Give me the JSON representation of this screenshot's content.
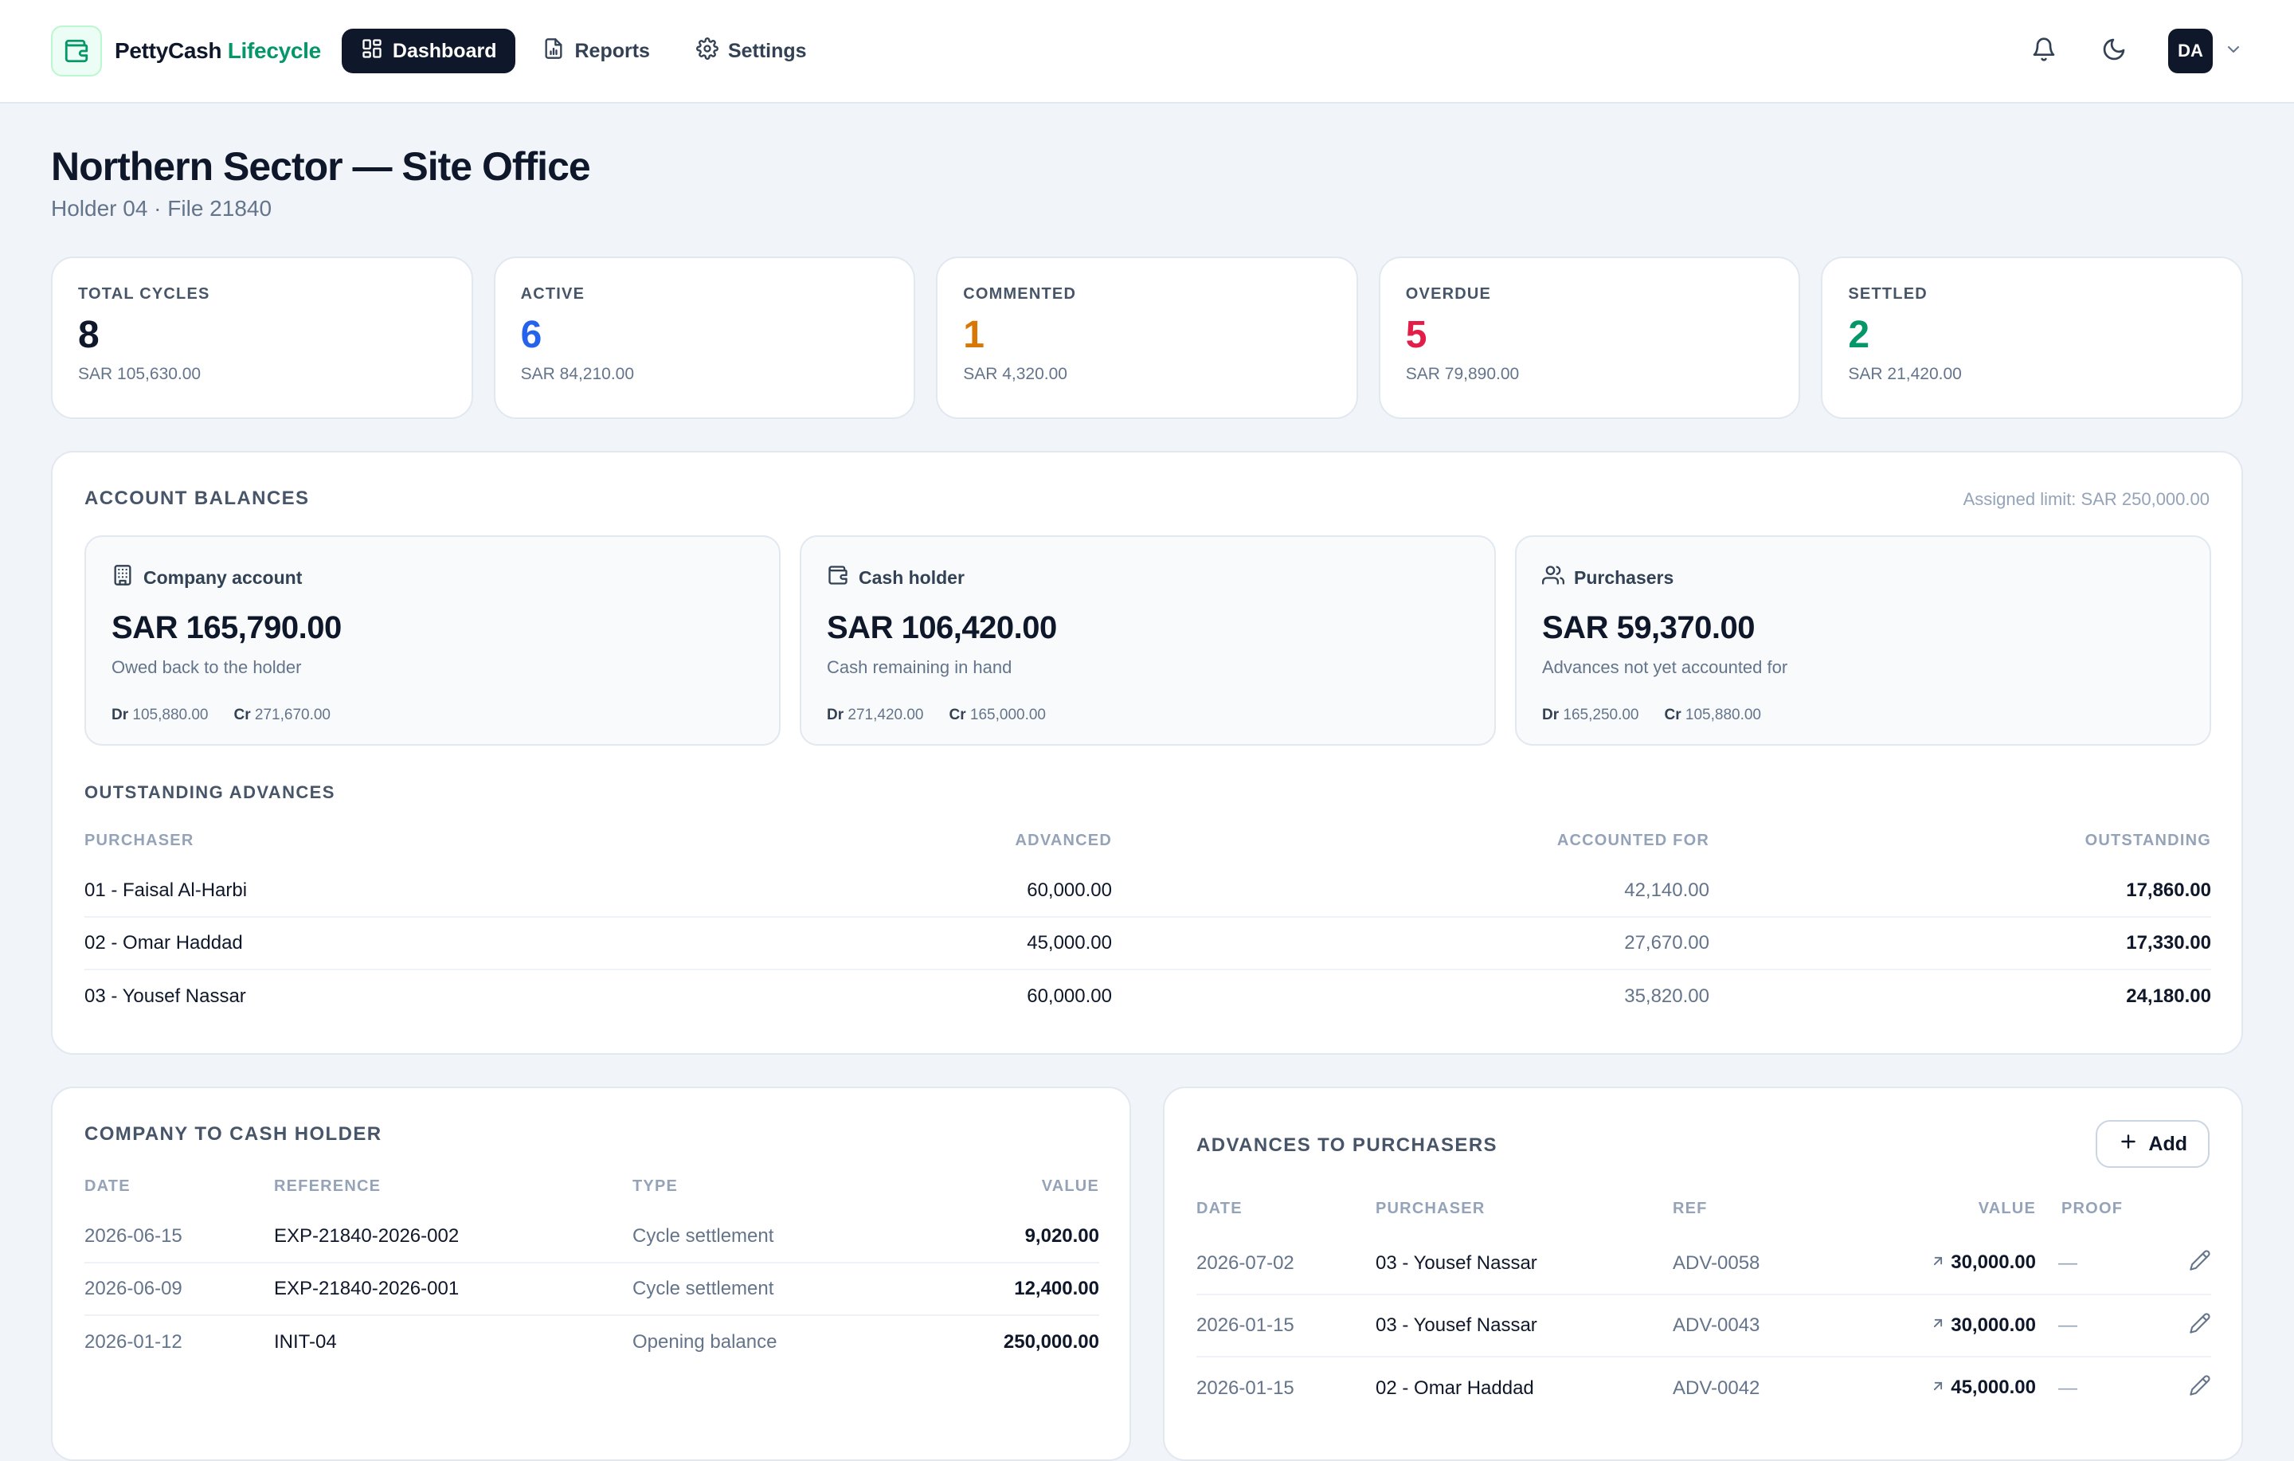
{
  "app": {
    "brand_main": "PettyCash",
    "brand_accent": "Lifecycle"
  },
  "nav": {
    "dashboard": "Dashboard",
    "reports": "Reports",
    "settings": "Settings"
  },
  "user": {
    "initials": "DA"
  },
  "page": {
    "title": "Northern Sector — Site Office",
    "subtitle": "Holder 04 · File 21840"
  },
  "stats": [
    {
      "label": "TOTAL CYCLES",
      "count": "8",
      "amount": "SAR 105,630.00",
      "color": "#0f172a"
    },
    {
      "label": "ACTIVE",
      "count": "6",
      "amount": "SAR 84,210.00",
      "color": "#2563eb"
    },
    {
      "label": "COMMENTED",
      "count": "1",
      "amount": "SAR 4,320.00",
      "color": "#d97706"
    },
    {
      "label": "OVERDUE",
      "count": "5",
      "amount": "SAR 79,890.00",
      "color": "#e11d48"
    },
    {
      "label": "SETTLED",
      "count": "2",
      "amount": "SAR 21,420.00",
      "color": "#059669"
    }
  ],
  "balances": {
    "title": "ACCOUNT BALANCES",
    "limit": "Assigned limit: SAR 250,000.00",
    "accounts": [
      {
        "name": "Company account",
        "icon": "building-icon",
        "amount": "SAR 165,790.00",
        "desc": "Owed back to the holder",
        "dr_label": "Dr",
        "dr": "105,880.00",
        "cr_label": "Cr",
        "cr": "271,670.00"
      },
      {
        "name": "Cash holder",
        "icon": "wallet-icon",
        "amount": "SAR 106,420.00",
        "desc": "Cash remaining in hand",
        "dr_label": "Dr",
        "dr": "271,420.00",
        "cr_label": "Cr",
        "cr": "165,000.00"
      },
      {
        "name": "Purchasers",
        "icon": "users-icon",
        "amount": "SAR 59,370.00",
        "desc": "Advances not yet accounted for",
        "dr_label": "Dr",
        "dr": "165,250.00",
        "cr_label": "Cr",
        "cr": "105,880.00"
      }
    ]
  },
  "outstanding": {
    "title": "OUTSTANDING ADVANCES",
    "columns": [
      "PURCHASER",
      "ADVANCED",
      "ACCOUNTED FOR",
      "OUTSTANDING"
    ],
    "rows": [
      {
        "purchaser": "01 - Faisal Al-Harbi",
        "advanced": "60,000.00",
        "accounted": "42,140.00",
        "outstanding": "17,860.00"
      },
      {
        "purchaser": "02 - Omar Haddad",
        "advanced": "45,000.00",
        "accounted": "27,670.00",
        "outstanding": "17,330.00"
      },
      {
        "purchaser": "03 - Yousef Nassar",
        "advanced": "60,000.00",
        "accounted": "35,820.00",
        "outstanding": "24,180.00"
      }
    ]
  },
  "company_to_holder": {
    "title": "COMPANY TO CASH HOLDER",
    "columns": [
      "DATE",
      "REFERENCE",
      "TYPE",
      "VALUE"
    ],
    "rows": [
      {
        "date": "2026-06-15",
        "reference": "EXP-21840-2026-002",
        "type": "Cycle settlement",
        "value": "9,020.00"
      },
      {
        "date": "2026-06-09",
        "reference": "EXP-21840-2026-001",
        "type": "Cycle settlement",
        "value": "12,400.00"
      },
      {
        "date": "2026-01-12",
        "reference": "INIT-04",
        "type": "Opening balance",
        "value": "250,000.00"
      }
    ]
  },
  "advances": {
    "title": "ADVANCES TO PURCHASERS",
    "add_label": "Add",
    "columns": [
      "DATE",
      "PURCHASER",
      "REF",
      "VALUE",
      "PROOF"
    ],
    "rows": [
      {
        "date": "2026-07-02",
        "purchaser": "03 - Yousef Nassar",
        "ref": "ADV-0058",
        "value": "30,000.00",
        "proof": "—"
      },
      {
        "date": "2026-01-15",
        "purchaser": "03 - Yousef Nassar",
        "ref": "ADV-0043",
        "value": "30,000.00",
        "proof": "—"
      },
      {
        "date": "2026-01-15",
        "purchaser": "02 - Omar Haddad",
        "ref": "ADV-0042",
        "value": "45,000.00",
        "proof": "—"
      }
    ]
  }
}
